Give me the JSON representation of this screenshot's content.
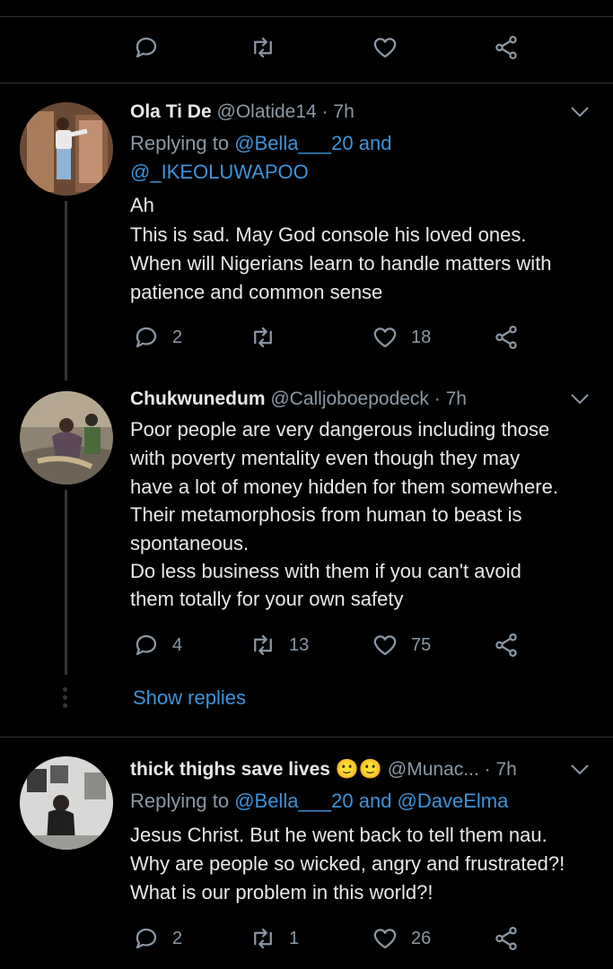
{
  "tweets": [
    {
      "name": "Ola Ti De",
      "handle": "@Olatide14",
      "time": "· 7h",
      "replying_prefix": "Replying to ",
      "replying_links": "@Bella___20 and",
      "replying_links2": "@_IKEOLUWAPOO",
      "lines": [
        "Ah",
        "This is sad. May God console his loved ones.",
        "When will Nigerians learn to handle matters with",
        "patience and common sense"
      ],
      "replies": "2",
      "retweets": "",
      "likes": "18"
    },
    {
      "name": "Chukwunedum",
      "handle": "@Calljoboepodeck",
      "time": "· 7h",
      "lines": [
        "Poor people are very dangerous including those",
        "with poverty mentality even though they may",
        "have a lot of money hidden for them somewhere.",
        "Their metamorphosis from human to beast is",
        "spontaneous.",
        "Do less business with them if you can't avoid",
        "them totally for your own safety"
      ],
      "replies": "4",
      "retweets": "13",
      "likes": "75",
      "show_replies": "Show replies"
    },
    {
      "name": "thick thighs save lives",
      "emojis": "🙂🙂",
      "handle": "@Munac...",
      "time": "· 7h",
      "replying_prefix": "Replying to ",
      "replying_links": "@Bella___20 and @DaveElma",
      "lines": [
        "Jesus Christ. But he went back to tell them nau.",
        "Why are people so wicked, angry and frustrated?!",
        "What is our problem in this world?!"
      ],
      "replies": "2",
      "retweets": "1",
      "likes": "26"
    }
  ],
  "colors": {
    "background": "#000000",
    "link": "#3b94d9",
    "muted": "#8b98a5",
    "text": "#e7e9ea"
  }
}
